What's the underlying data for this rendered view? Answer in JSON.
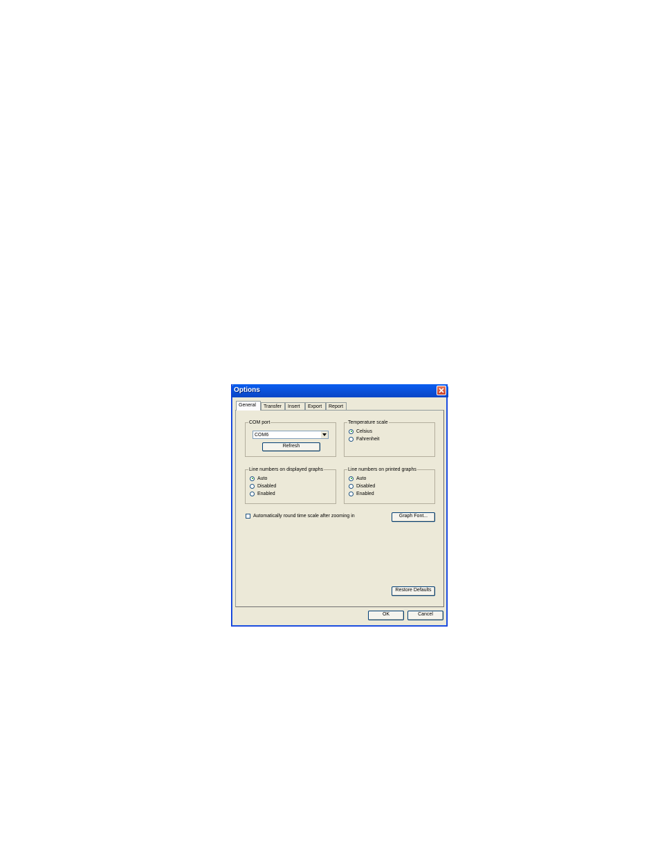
{
  "window": {
    "title": "Options",
    "close_label": "×"
  },
  "tabs": [
    {
      "label": "General",
      "active": true
    },
    {
      "label": "Transfer",
      "active": false
    },
    {
      "label": "Insert",
      "active": false
    },
    {
      "label": "Export",
      "active": false
    },
    {
      "label": "Report",
      "active": false
    }
  ],
  "com_port": {
    "legend": "COM port",
    "selected": "COM6",
    "refresh_label": "Refresh"
  },
  "temperature": {
    "legend": "Temperature scale",
    "options": [
      {
        "label": "Celsius",
        "checked": true
      },
      {
        "label": "Fahrenheit",
        "checked": false
      }
    ]
  },
  "line_displayed": {
    "legend": "Line numbers on displayed graphs",
    "options": [
      {
        "label": "Auto",
        "checked": true
      },
      {
        "label": "Disabled",
        "checked": false
      },
      {
        "label": "Enabled",
        "checked": false
      }
    ]
  },
  "line_printed": {
    "legend": "Line numbers on printed graphs",
    "options": [
      {
        "label": "Auto",
        "checked": true
      },
      {
        "label": "Disabled",
        "checked": false
      },
      {
        "label": "Enabled",
        "checked": false
      }
    ]
  },
  "auto_round": {
    "label": "Automatically round time scale after zooming in",
    "checked": false
  },
  "buttons": {
    "graph_font": "Graph Font...",
    "restore_defaults": "Restore Defaults",
    "ok": "OK",
    "cancel": "Cancel"
  },
  "colors": {
    "titlebar": "#0b4fd5",
    "dialog_bg": "#ece9d8",
    "close": "#c8432a"
  }
}
